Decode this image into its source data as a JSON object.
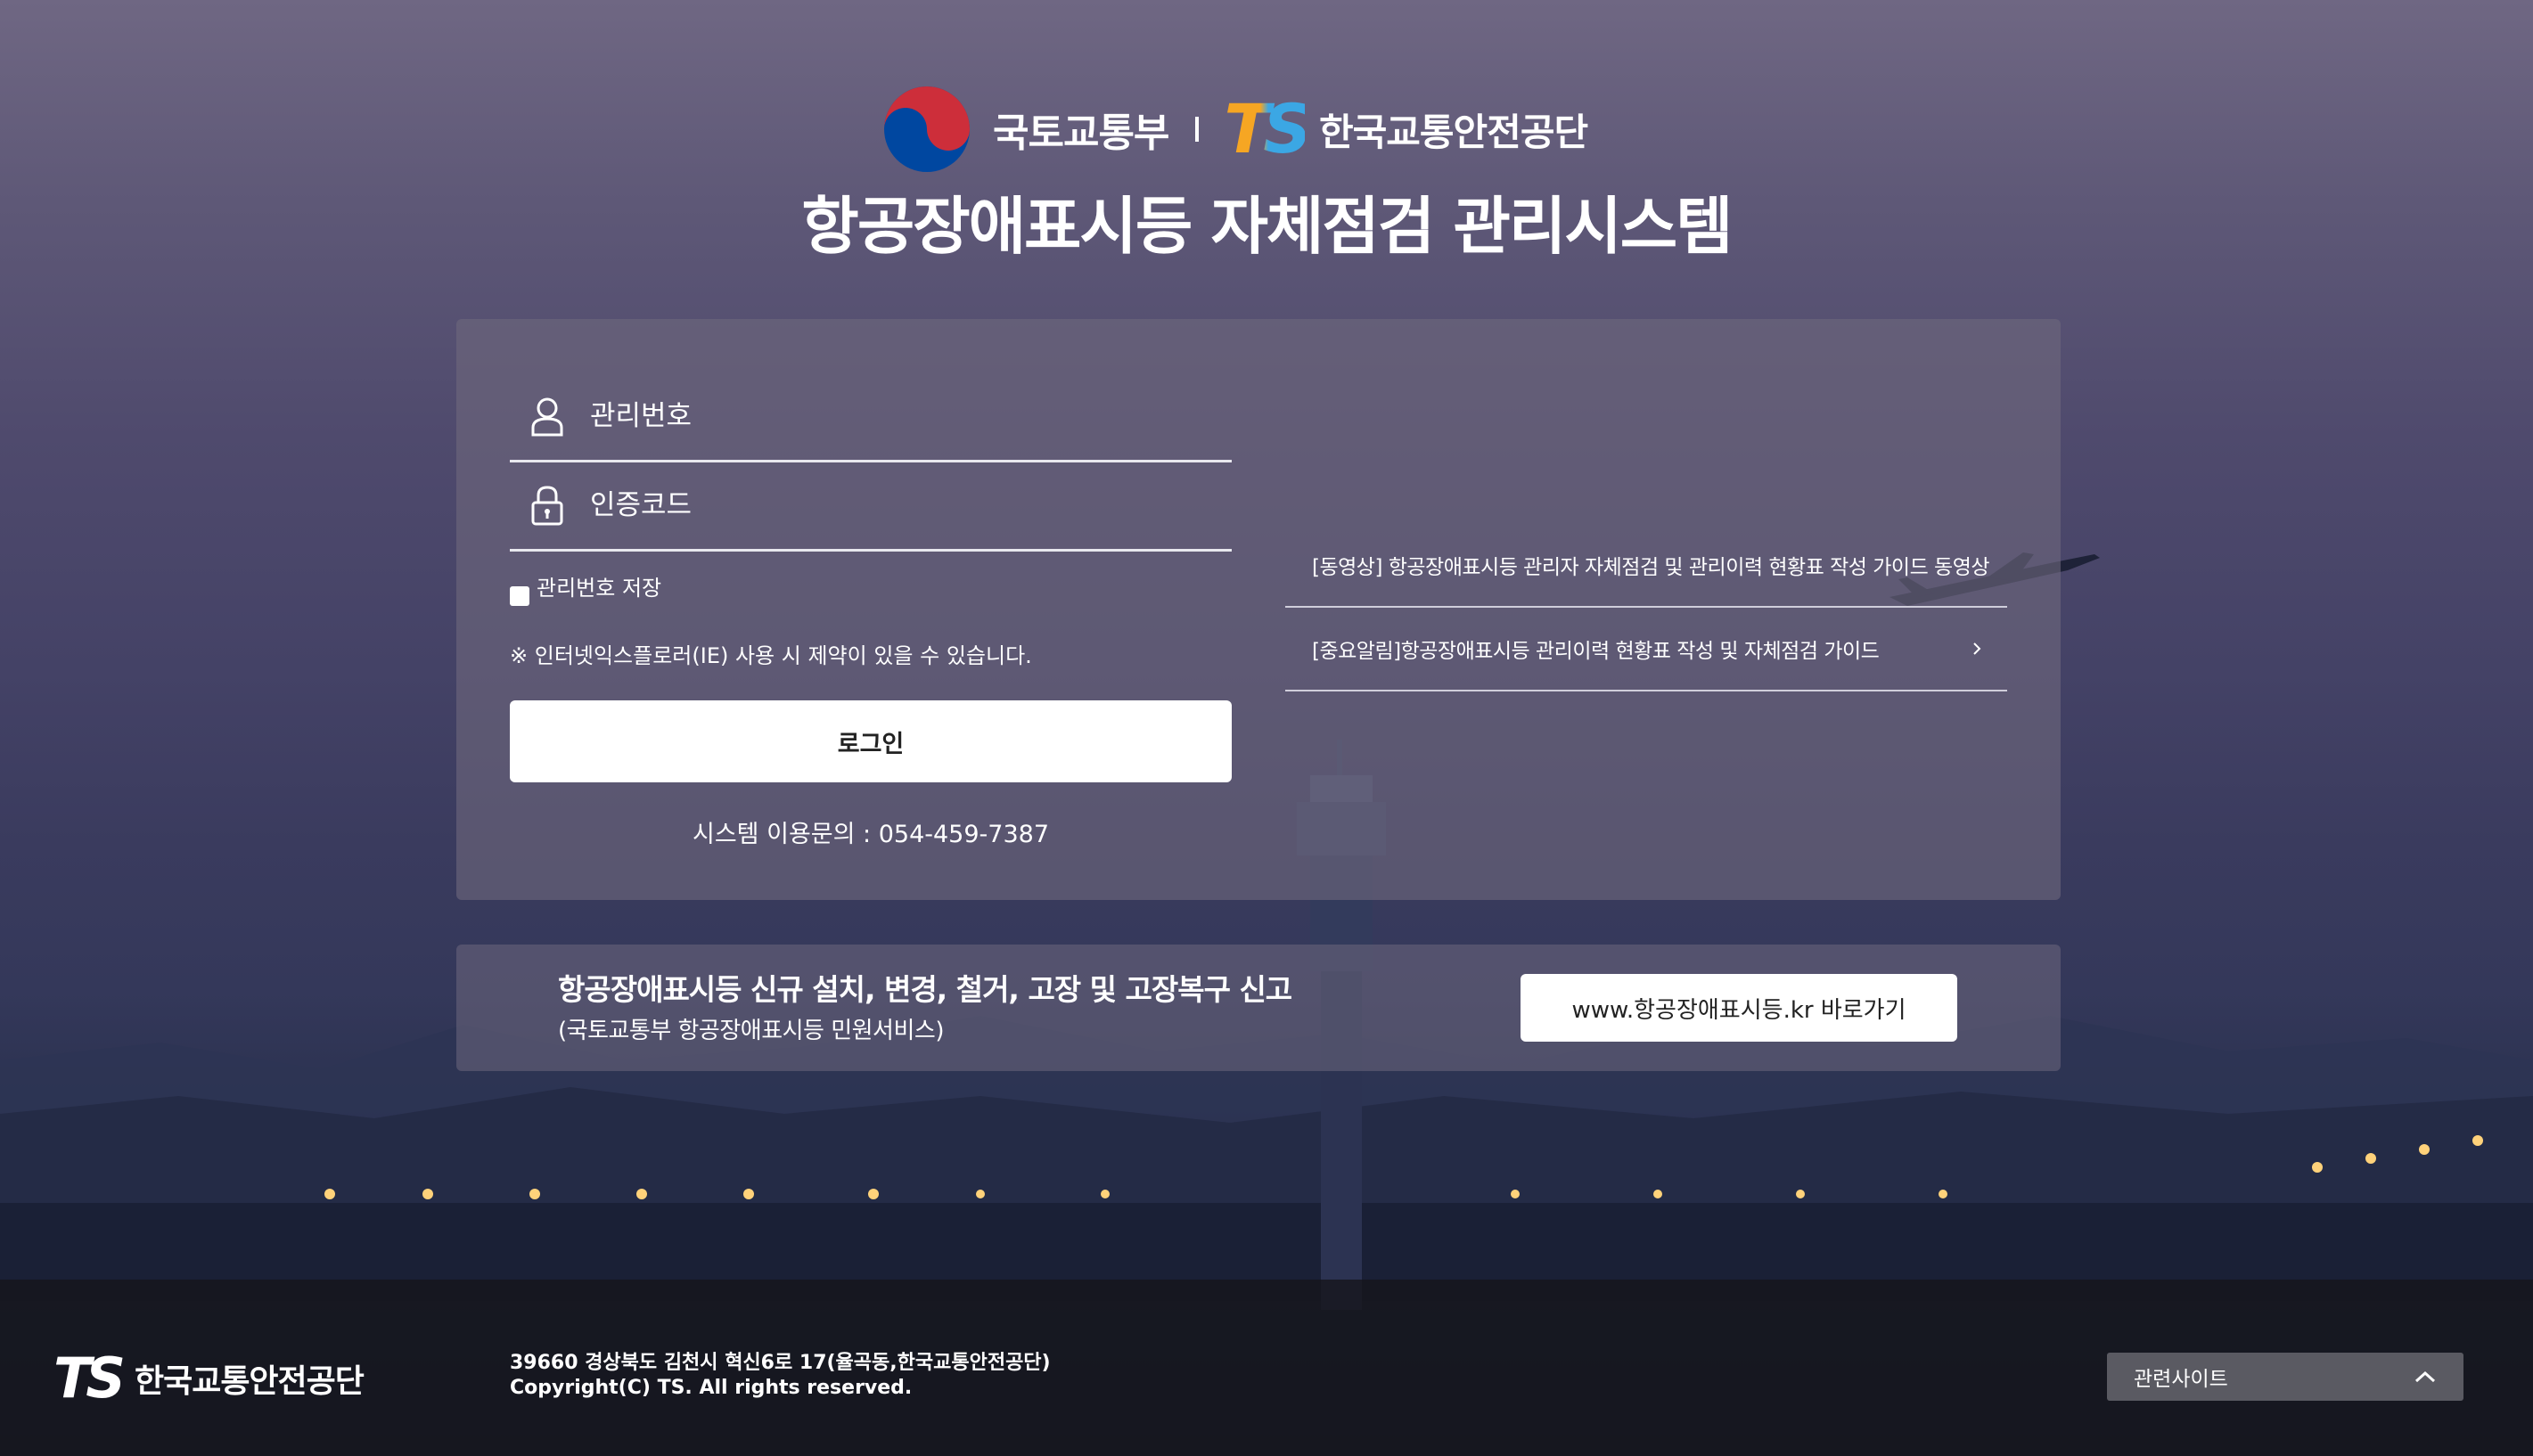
{
  "header": {
    "ministry_name": "국토교통부",
    "ts_mark": "TS",
    "ts_name": "한국교통안전공단",
    "title": "항공장애표시등 자체점검 관리시스템"
  },
  "login": {
    "id_placeholder": "관리번호",
    "code_placeholder": "인증코드",
    "save_label": "관리번호 저장",
    "ie_notice": "※ 인터넷익스플로러(IE) 사용 시 제약이 있을 수 있습니다.",
    "login_button": "로그인",
    "contact": "시스템 이용문의 : 054-459-7387"
  },
  "notices": [
    {
      "text": "[동영상] 항공장애표시등 관리자 자체점검 및 관리이력 현황표 작성 가이드 동영상"
    },
    {
      "text": "[중요알림]항공장애표시등 관리이력 현황표 작성 및 자체점검 가이드"
    }
  ],
  "complaint": {
    "title": "항공장애표시등 신규 설치, 변경, 철거, 고장 및 고장복구 신고",
    "subtitle": "(국토교통부 항공장애표시등 민원서비스)",
    "link_button": "www.항공장애표시등.kr 바로가기"
  },
  "footer": {
    "logo_mark": "TS",
    "logo_text": "한국교통안전공단",
    "address": "39660 경상북도 김천시 혁신6로 17(율곡동,한국교통안전공단)",
    "copyright": "Copyright(C) TS. All rights reserved.",
    "related_sites": "관련사이트"
  },
  "colors": {
    "ts_orange": "#f6a623",
    "ts_blue": "#3ba7e4",
    "emblem_red": "#cd2e3a",
    "emblem_blue": "#0047a0"
  },
  "icons": {
    "id_field": "user-icon",
    "code_field": "lock-icon",
    "notice_arrow": "chevron-right-icon",
    "related_sites": "chevron-up-icon"
  }
}
